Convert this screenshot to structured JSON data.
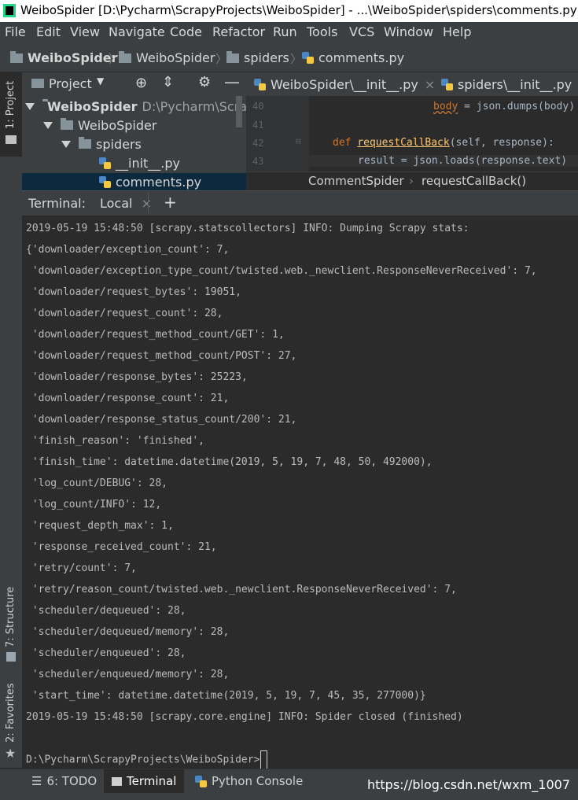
{
  "window": {
    "title": "WeiboSpider [D:\\Pycharm\\ScrapyProjects\\WeiboSpider] - ...\\WeiboSpider\\spiders\\comments.py [We"
  },
  "menu": [
    "File",
    "Edit",
    "View",
    "Navigate",
    "Code",
    "Refactor",
    "Run",
    "Tools",
    "VCS",
    "Window",
    "Help"
  ],
  "menu_mnemonics": [
    "F",
    "E",
    "V",
    "N",
    "C",
    "R",
    "u",
    "T",
    "S",
    "W",
    "H"
  ],
  "breadcrumb": [
    "WeiboSpider",
    "WeiboSpider",
    "spiders",
    "comments.py"
  ],
  "left_stripe": {
    "project_tab": "1: Project",
    "structure_tab": "7: Structure",
    "favorites_tab": "2: Favorites"
  },
  "project_panel": {
    "title": "Project",
    "tree": [
      {
        "label": "WeiboSpider",
        "path": "D:\\Pycharm\\Scrap"
      },
      {
        "label": "WeiboSpider"
      },
      {
        "label": "spiders"
      },
      {
        "label": "__init__.py"
      },
      {
        "label": "comments.py"
      }
    ]
  },
  "editor": {
    "tabs": [
      "WeiboSpider\\__init__.py",
      "spiders\\__init__.py"
    ],
    "line_numbers": [
      "40",
      "41",
      "42",
      "43"
    ],
    "lines": {
      "l40_var": "body",
      "l40_rest": " = json.dumps(body)",
      "l42_kw": "def ",
      "l42_fn": "requestCallBack",
      "l42_rest": "(self, response):",
      "l43": "result = json.loads(response.text)"
    },
    "crumb_class": "CommentSpider",
    "crumb_method": "requestCallBack()"
  },
  "terminal": {
    "label": "Terminal:",
    "tab": "Local",
    "add": "+",
    "lines": [
      "2019-05-19 15:48:50 [scrapy.statscollectors] INFO: Dumping Scrapy stats:",
      "{'downloader/exception_count': 7,",
      " 'downloader/exception_type_count/twisted.web._newclient.ResponseNeverReceived': 7,",
      " 'downloader/request_bytes': 19051,",
      " 'downloader/request_count': 28,",
      " 'downloader/request_method_count/GET': 1,",
      " 'downloader/request_method_count/POST': 27,",
      " 'downloader/response_bytes': 25223,",
      " 'downloader/response_count': 21,",
      " 'downloader/response_status_count/200': 21,",
      " 'finish_reason': 'finished',",
      " 'finish_time': datetime.datetime(2019, 5, 19, 7, 48, 50, 492000),",
      " 'log_count/DEBUG': 28,",
      " 'log_count/INFO': 12,",
      " 'request_depth_max': 1,",
      " 'response_received_count': 21,",
      " 'retry/count': 7,",
      " 'retry/reason_count/twisted.web._newclient.ResponseNeverReceived': 7,",
      " 'scheduler/dequeued': 28,",
      " 'scheduler/dequeued/memory': 28,",
      " 'scheduler/enqueued': 28,",
      " 'scheduler/enqueued/memory': 28,",
      " 'start_time': datetime.datetime(2019, 5, 19, 7, 45, 35, 277000)}",
      "2019-05-19 15:48:50 [scrapy.core.engine] INFO: Spider closed (finished)"
    ],
    "prompt": "D:\\Pycharm\\ScrapyProjects\\WeiboSpider>"
  },
  "bottom": {
    "todo": "6: TODO",
    "terminal": "Terminal",
    "python_console": "Python Console",
    "watermark": "https://blog.csdn.net/wxm_1007"
  },
  "colors": {
    "background": "#2b2b2b",
    "panel": "#3c3f41",
    "keyword": "#cc7832",
    "text": "#bbbbbb"
  }
}
